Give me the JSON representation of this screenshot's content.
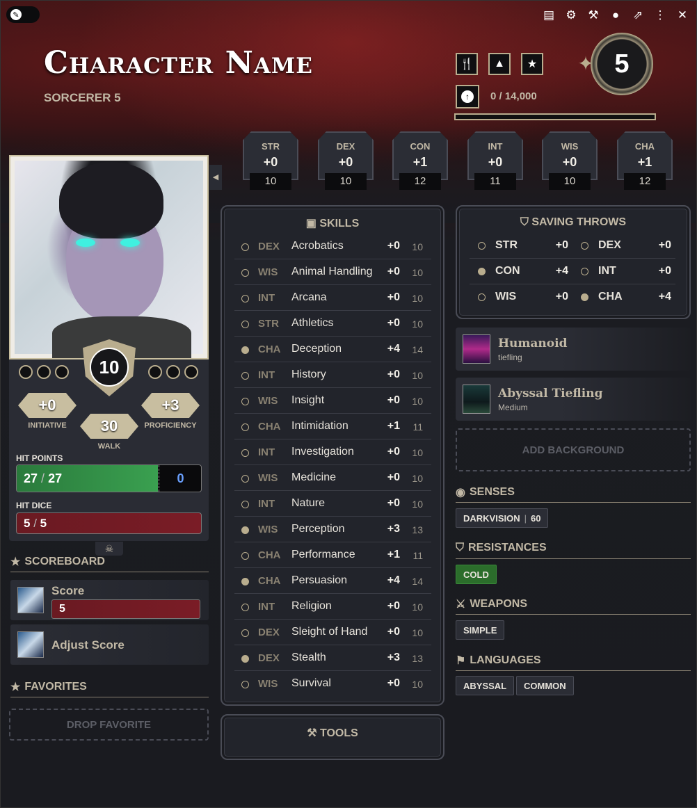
{
  "window": {
    "top_icons": [
      "journal-icon",
      "gear-icon",
      "wrench-icon",
      "user-circle-icon",
      "external-link-icon",
      "kebab-menu-icon",
      "close-icon"
    ]
  },
  "header": {
    "character_name": "Character Name",
    "class_line": "SORCERER 5",
    "level": "5",
    "xp_text": "0 / 14,000",
    "xp_progress": 0,
    "buttons": [
      "utensils-icon",
      "camp-icon",
      "star-icon"
    ]
  },
  "abilities": [
    {
      "abbr": "STR",
      "mod": "+0",
      "score": "10"
    },
    {
      "abbr": "DEX",
      "mod": "+0",
      "score": "10"
    },
    {
      "abbr": "CON",
      "mod": "+1",
      "score": "12"
    },
    {
      "abbr": "INT",
      "mod": "+0",
      "score": "11"
    },
    {
      "abbr": "WIS",
      "mod": "+0",
      "score": "10"
    },
    {
      "abbr": "CHA",
      "mod": "+1",
      "score": "12"
    }
  ],
  "combat": {
    "ac": "10",
    "initiative": "+0",
    "initiative_label": "INITIATIVE",
    "proficiency": "+3",
    "proficiency_label": "PROFICIENCY",
    "walk": "30",
    "walk_label": "WALK",
    "hp_label": "HIT POINTS",
    "hp_current": "27",
    "hp_sep": "/",
    "hp_max": "27",
    "hp_temp": "0",
    "hd_label": "HIT DICE",
    "hd_current": "5",
    "hd_sep": "/",
    "hd_max": "5"
  },
  "scoreboard": {
    "title": "SCOREBOARD",
    "items": [
      {
        "name": "Score",
        "value": "5"
      },
      {
        "name": "Adjust Score"
      }
    ]
  },
  "favorites": {
    "title": "FAVORITES",
    "drop_label": "DROP FAVORITE"
  },
  "skills": {
    "title": "SKILLS",
    "rows": [
      {
        "abil": "DEX",
        "name": "Acrobatics",
        "bonus": "+0",
        "passive": "10",
        "prof": false
      },
      {
        "abil": "WIS",
        "name": "Animal Handling",
        "bonus": "+0",
        "passive": "10",
        "prof": false
      },
      {
        "abil": "INT",
        "name": "Arcana",
        "bonus": "+0",
        "passive": "10",
        "prof": false
      },
      {
        "abil": "STR",
        "name": "Athletics",
        "bonus": "+0",
        "passive": "10",
        "prof": false
      },
      {
        "abil": "CHA",
        "name": "Deception",
        "bonus": "+4",
        "passive": "14",
        "prof": true
      },
      {
        "abil": "INT",
        "name": "History",
        "bonus": "+0",
        "passive": "10",
        "prof": false
      },
      {
        "abil": "WIS",
        "name": "Insight",
        "bonus": "+0",
        "passive": "10",
        "prof": false
      },
      {
        "abil": "CHA",
        "name": "Intimidation",
        "bonus": "+1",
        "passive": "11",
        "prof": false
      },
      {
        "abil": "INT",
        "name": "Investigation",
        "bonus": "+0",
        "passive": "10",
        "prof": false
      },
      {
        "abil": "WIS",
        "name": "Medicine",
        "bonus": "+0",
        "passive": "10",
        "prof": false
      },
      {
        "abil": "INT",
        "name": "Nature",
        "bonus": "+0",
        "passive": "10",
        "prof": false
      },
      {
        "abil": "WIS",
        "name": "Perception",
        "bonus": "+3",
        "passive": "13",
        "prof": true
      },
      {
        "abil": "CHA",
        "name": "Performance",
        "bonus": "+1",
        "passive": "11",
        "prof": false
      },
      {
        "abil": "CHA",
        "name": "Persuasion",
        "bonus": "+4",
        "passive": "14",
        "prof": true
      },
      {
        "abil": "INT",
        "name": "Religion",
        "bonus": "+0",
        "passive": "10",
        "prof": false
      },
      {
        "abil": "DEX",
        "name": "Sleight of Hand",
        "bonus": "+0",
        "passive": "10",
        "prof": false
      },
      {
        "abil": "DEX",
        "name": "Stealth",
        "bonus": "+3",
        "passive": "13",
        "prof": true
      },
      {
        "abil": "WIS",
        "name": "Survival",
        "bonus": "+0",
        "passive": "10",
        "prof": false
      }
    ]
  },
  "tools": {
    "title": "TOOLS"
  },
  "saving_throws": {
    "title": "SAVING THROWS",
    "rows": [
      {
        "abbr": "STR",
        "val": "+0",
        "prof": false
      },
      {
        "abbr": "DEX",
        "val": "+0",
        "prof": false
      },
      {
        "abbr": "CON",
        "val": "+4",
        "prof": true
      },
      {
        "abbr": "INT",
        "val": "+0",
        "prof": false
      },
      {
        "abbr": "WIS",
        "val": "+0",
        "prof": false
      },
      {
        "abbr": "CHA",
        "val": "+4",
        "prof": true
      }
    ]
  },
  "traits": [
    {
      "name": "Humanoid",
      "sub": "tiefling"
    },
    {
      "name": "Abyssal Tiefling",
      "sub": "Medium"
    }
  ],
  "background": {
    "add_label": "ADD BACKGROUND"
  },
  "senses": {
    "title": "SENSES",
    "tag_name": "DARKVISION",
    "tag_sep": "|",
    "tag_value": "60"
  },
  "resistances": {
    "title": "RESISTANCES",
    "tags": [
      "COLD"
    ],
    "tag_color": "#2b6d2b"
  },
  "weapons": {
    "title": "WEAPONS",
    "tags": [
      "SIMPLE"
    ]
  },
  "languages": {
    "title": "LANGUAGES",
    "tags": [
      "ABYSSAL",
      "COMMON"
    ]
  },
  "colors": {
    "accent": "#b9ad8e",
    "hp_green": "#3aa050",
    "hd_red": "#7a1c26"
  }
}
